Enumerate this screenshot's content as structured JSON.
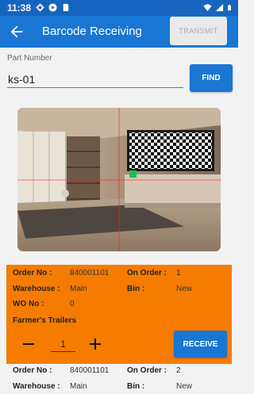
{
  "status_bar": {
    "time": "11:38",
    "left_icons": [
      "gear-icon",
      "play-icon",
      "sd-card-icon"
    ],
    "right_icons": [
      "wifi-icon",
      "signal-icon",
      "battery-icon"
    ]
  },
  "app_bar": {
    "title": "Barcode Receiving",
    "transmit_label": "TRANSMIT",
    "back_icon": "arrow-left-icon"
  },
  "search": {
    "label": "Part Number",
    "value": "ks-01",
    "find_label": "FIND"
  },
  "camera": {
    "description_icon": "camera-preview"
  },
  "orders": [
    {
      "order_no_label": "Order No :",
      "order_no": "840001101",
      "on_order_label": "On Order :",
      "on_order": "1",
      "warehouse_label": "Warehouse :",
      "warehouse": "Main",
      "bin_label": "Bin :",
      "bin": "New",
      "wo_no_label": "WO No :",
      "wo_no": "0",
      "customer": "Farmer's Trailers",
      "quantity": "1",
      "receive_label": "RECEIVE"
    },
    {
      "order_no_label": "Order No :",
      "order_no": "840001101",
      "on_order_label": "On Order :",
      "on_order": "2",
      "warehouse_label": "Warehouse :",
      "warehouse": "Main",
      "bin_label": "Bin :",
      "bin": "New"
    }
  ],
  "colors": {
    "app_bar": "#1976d2",
    "status_bar": "#1565c0",
    "active_card": "#f57c00",
    "button": "#1976d2"
  }
}
